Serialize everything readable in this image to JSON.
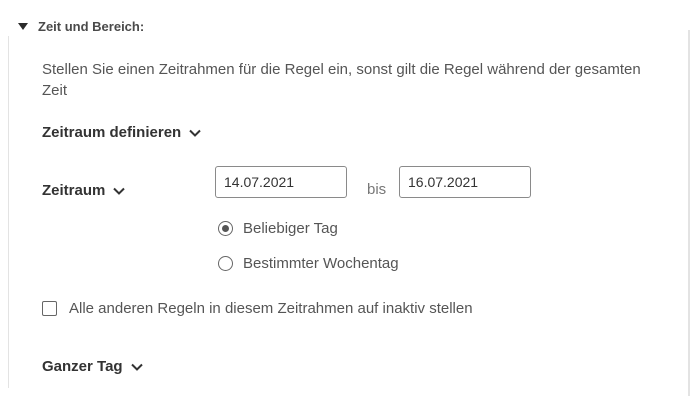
{
  "section": {
    "title": "Zeit und Bereich:",
    "expanded": true,
    "description": "Stellen Sie einen Zeitrahmen für die Regel ein, sonst gilt die Regel während der gesamten Zeit"
  },
  "define_period": {
    "label": "Zeitraum definieren"
  },
  "period": {
    "label": "Zeitraum",
    "from_value": "14.07.2021",
    "separator": "bis",
    "to_value": "16.07.2021"
  },
  "day_options": [
    {
      "label": "Beliebiger Tag",
      "selected": true
    },
    {
      "label": "Bestimmter Wochentag",
      "selected": false
    }
  ],
  "deactivate_others": {
    "label": "Alle anderen Regeln in diesem Zeitrahmen auf inaktiv stellen",
    "checked": false
  },
  "whole_day": {
    "label": "Ganzer Tag"
  },
  "icons": {
    "section_toggle": "triangle-down-icon",
    "dropdown": "chevron-down-icon"
  }
}
